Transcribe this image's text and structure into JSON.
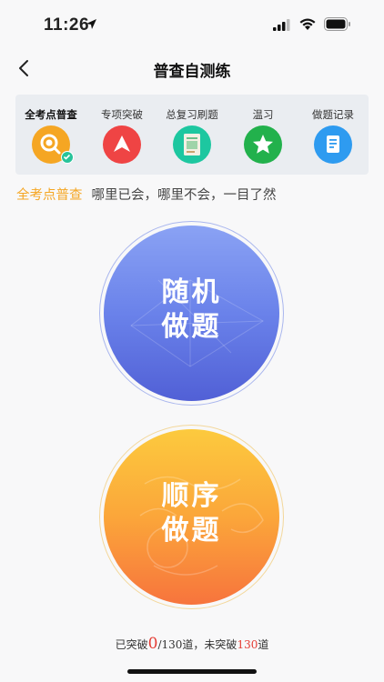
{
  "status_bar": {
    "time": "11:26"
  },
  "nav": {
    "title": "普查自测练"
  },
  "tabs": [
    {
      "label": "全考点普查",
      "icon": "search-icon",
      "color": "#f5a623",
      "active": true
    },
    {
      "label": "专项突破",
      "icon": "arrow-up-icon",
      "color": "#ef4444",
      "active": false
    },
    {
      "label": "总复习刷题",
      "icon": "book-icon",
      "color": "#1dc7a0",
      "active": false
    },
    {
      "label": "温习",
      "icon": "star-icon",
      "color": "#22b14c",
      "active": false
    },
    {
      "label": "做题记录",
      "icon": "note-icon",
      "color": "#2e9bf0",
      "active": false
    }
  ],
  "subtitle": {
    "key": "全考点普查",
    "desc": "哪里已会，哪里不会，一目了然"
  },
  "buttons": {
    "random": {
      "line1": "随机",
      "line2": "做题"
    },
    "order": {
      "line1": "顺序",
      "line2": "做题"
    }
  },
  "stats": {
    "prefix": "已突破",
    "broken": "0",
    "mid": "/130道，未突破",
    "remaining": "130",
    "suffix": "道"
  },
  "colors": {
    "accent": "#f5a623",
    "highlight": "#e43b33"
  }
}
